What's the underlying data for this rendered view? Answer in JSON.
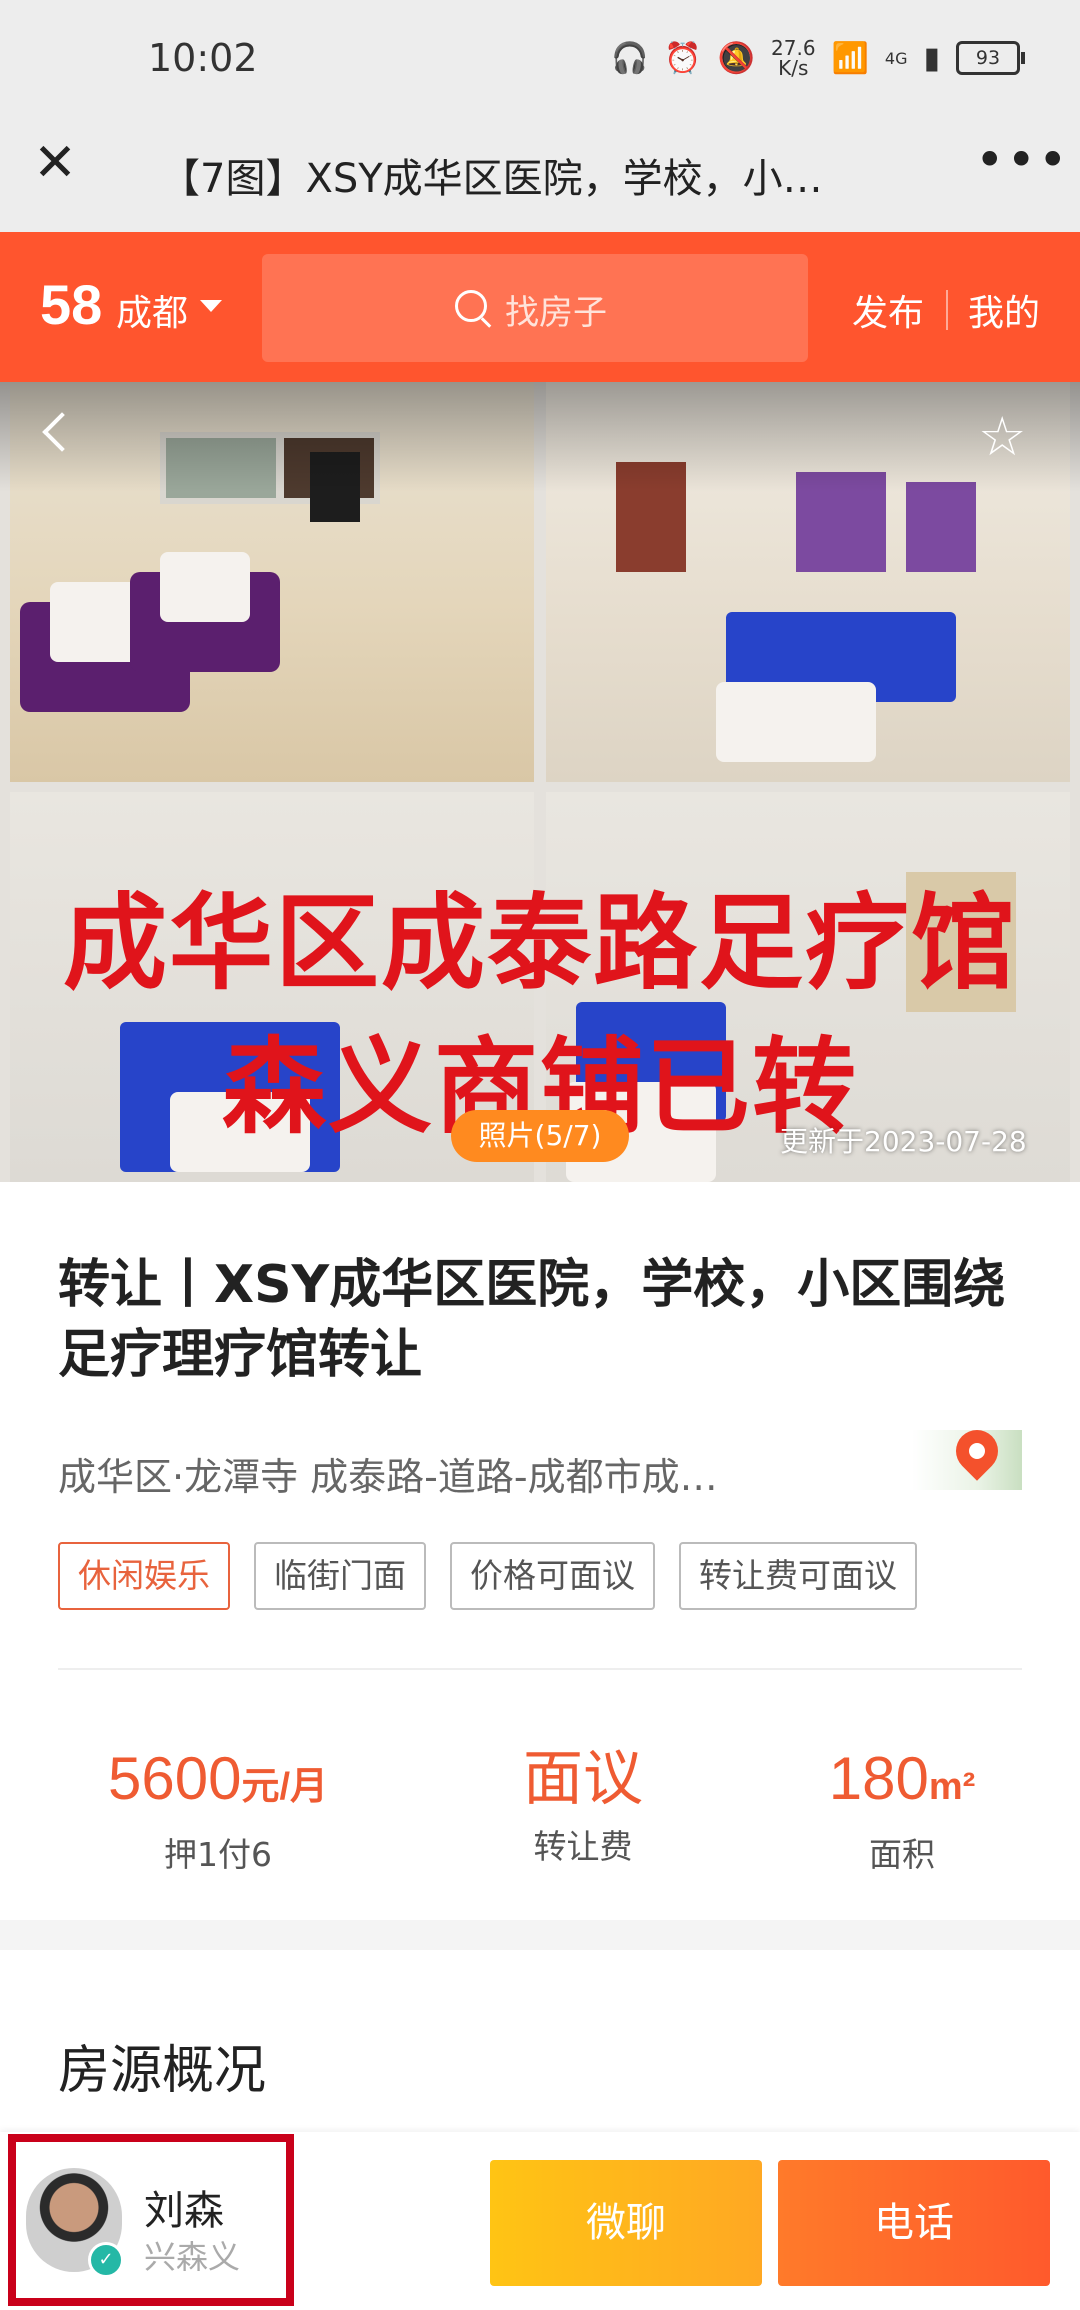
{
  "status_bar": {
    "time": "10:02",
    "net_speed_value": "27.6",
    "net_speed_unit": "K/s",
    "signal_label": "4G",
    "battery": "93"
  },
  "title_bar": {
    "title": "【7图】XSY成华区医院，学校，小…"
  },
  "header": {
    "logo": "58",
    "city": "成都",
    "search_placeholder": "找房子",
    "publish": "发布",
    "mine": "我的"
  },
  "gallery": {
    "overlay_line1": "成华区成泰路足疗馆",
    "overlay_line2": "森义商铺已转",
    "photo_count": "照片(5/7)",
    "updated": "更新于2023-07-28"
  },
  "listing": {
    "title": "转让丨XSY成华区医院，学校，小区围绕足疗理疗馆转让",
    "address": "成华区·龙潭寺 成泰路-道路-成都市成…",
    "tags": [
      "休闲娱乐",
      "临街门面",
      "价格可面议",
      "转让费可面议"
    ],
    "rent_value": "5600",
    "rent_unit": "元/月",
    "rent_label": "押1付6",
    "transfer_value": "面议",
    "transfer_label": "转让费",
    "area_value": "180",
    "area_unit": "m²",
    "area_label": "面积",
    "section_title": "房源概况"
  },
  "bottom_bar": {
    "agent_name": "刘森",
    "agent_company": "兴森义",
    "chat_button": "微聊",
    "call_button": "电话"
  },
  "colors": {
    "brand_orange": "#ff552e",
    "price_orange": "#ef5b32",
    "chat_yellow": "#ffb81c",
    "highlight_red": "#c9001a"
  }
}
